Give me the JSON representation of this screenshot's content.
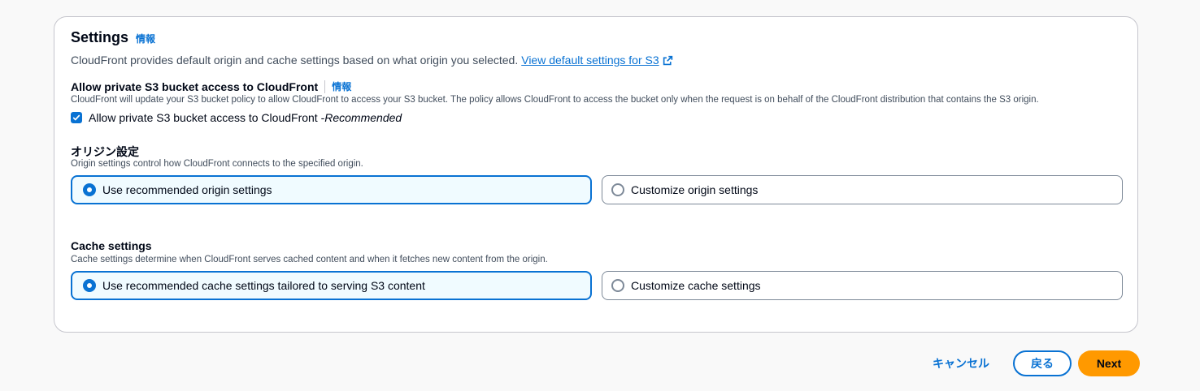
{
  "settings": {
    "title": "Settings",
    "info_label": "情報",
    "description": "CloudFront provides default origin and cache settings based on what origin you selected.",
    "link_text": "View default settings for S3"
  },
  "s3_access": {
    "label": "Allow private S3 bucket access to CloudFront",
    "info_label": "情報",
    "description": "CloudFront will update your S3 bucket policy to allow CloudFront to access your S3 bucket. The policy allows CloudFront to access the bucket only when the request is on behalf of the CloudFront distribution that contains the S3 origin.",
    "checkbox_label": "Allow private S3 bucket access to CloudFront - ",
    "checkbox_suffix": "Recommended",
    "checked": true
  },
  "origin": {
    "label": "オリジン設定",
    "description": "Origin settings control how CloudFront connects to the specified origin.",
    "options": [
      {
        "label": "Use recommended origin settings",
        "selected": true
      },
      {
        "label": "Customize origin settings",
        "selected": false
      }
    ]
  },
  "cache": {
    "label": "Cache settings",
    "description": "Cache settings determine when CloudFront serves cached content and when it fetches new content from the origin.",
    "options": [
      {
        "label": "Use recommended cache settings tailored to serving S3 content",
        "selected": true
      },
      {
        "label": "Customize cache settings",
        "selected": false
      }
    ]
  },
  "footer": {
    "cancel_label": "キャンセル",
    "back_label": "戻る",
    "next_label": "Next"
  },
  "colors": {
    "accent": "#0972d3",
    "primary_button": "#ff9900",
    "selected_tile_bg": "#f0fbff"
  },
  "icons": {
    "external_link": "external-link-icon",
    "checkbox_check": "check-icon",
    "radio": "radio-icon"
  }
}
